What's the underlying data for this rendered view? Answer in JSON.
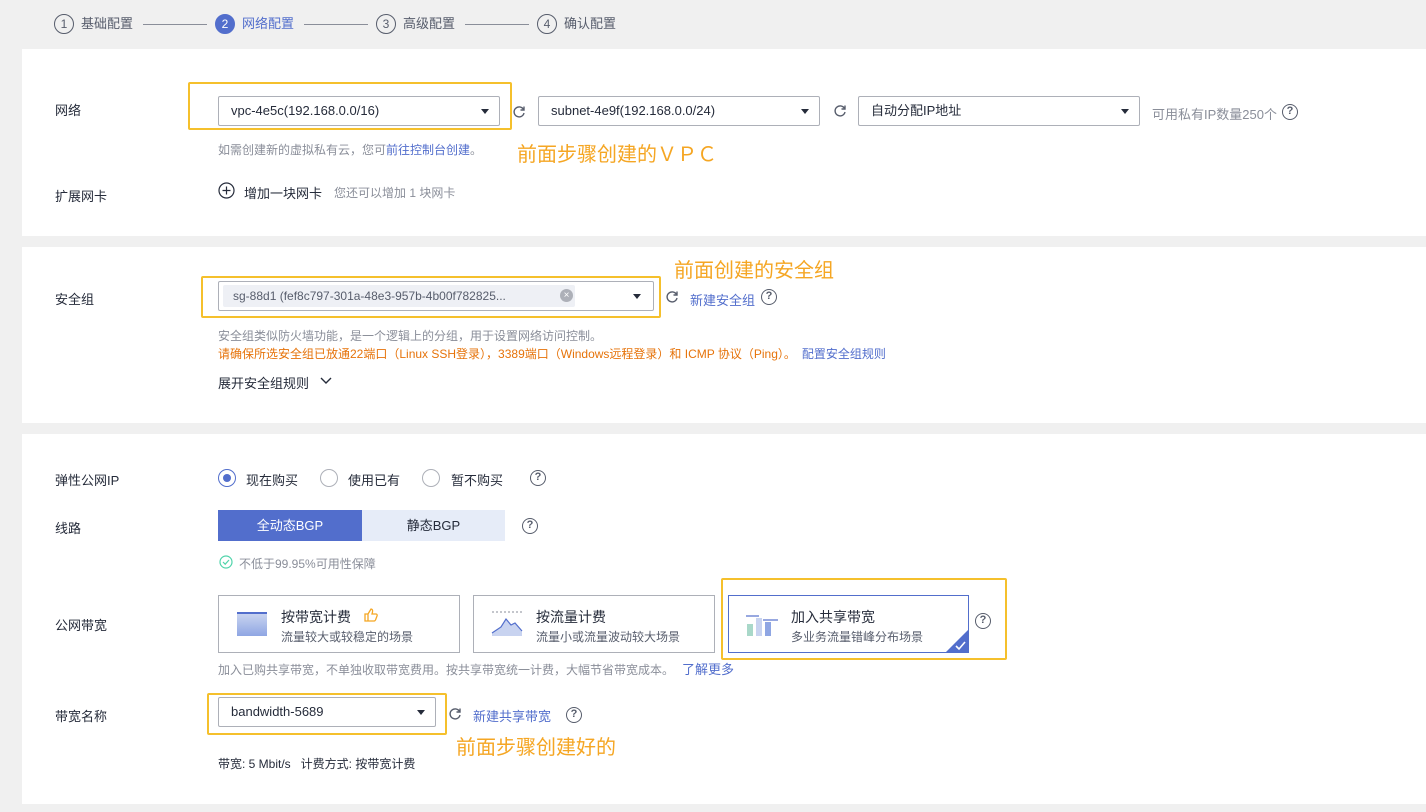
{
  "steps": [
    {
      "num": "1",
      "label": "基础配置"
    },
    {
      "num": "2",
      "label": "网络配置"
    },
    {
      "num": "3",
      "label": "高级配置"
    },
    {
      "num": "4",
      "label": "确认配置"
    }
  ],
  "network": {
    "label": "网络",
    "vpc_value": "vpc-4e5c(192.168.0.0/16)",
    "subnet_value": "subnet-4e9f(192.168.0.0/24)",
    "ip_value": "自动分配IP地址",
    "ip_count": "可用私有IP数量250个",
    "hint_prefix": "如需创建新的虚拟私有云，您可",
    "hint_link": "前往控制台创建",
    "hint_suffix": "。",
    "annotation": "前面步骤创建的ＶＰＣ"
  },
  "nic": {
    "label": "扩展网卡",
    "add_label": "增加一块网卡",
    "hint": "您还可以增加 1 块网卡"
  },
  "security": {
    "label": "安全组",
    "tag_value": "sg-88d1 (fef8c797-301a-48e3-957b-4b00f782825...",
    "new_link": "新建安全组",
    "annotation": "前面创建的安全组",
    "desc": "安全组类似防火墙功能，是一个逻辑上的分组，用于设置网络访问控制。",
    "warning": "请确保所选安全组已放通22端口（Linux SSH登录），3389端口（Windows远程登录）和 ICMP 协议（Ping）。",
    "rules_link": "配置安全组规则",
    "expand_label": "展开安全组规则"
  },
  "eip": {
    "label": "弹性公网IP",
    "options": [
      "现在购买",
      "使用已有",
      "暂不购买"
    ]
  },
  "line": {
    "label": "线路",
    "options": [
      "全动态BGP",
      "静态BGP"
    ],
    "guarantee": "不低于99.95%可用性保障"
  },
  "bandwidth": {
    "label": "公网带宽",
    "cards": [
      {
        "title": "按带宽计费",
        "desc": "流量较大或较稳定的场景"
      },
      {
        "title": "按流量计费",
        "desc": "流量小或流量波动较大场景"
      },
      {
        "title": "加入共享带宽",
        "desc": "多业务流量错峰分布场景"
      }
    ],
    "hint": "加入已购共享带宽，不单独收取带宽费用。按共享带宽统一计费，大幅节省带宽成本。",
    "learn_more": "了解更多"
  },
  "bw_name": {
    "label": "带宽名称",
    "value": "bandwidth-5689",
    "new_link": "新建共享带宽",
    "annotation": "前面步骤创建好的",
    "info": "带宽: 5 Mbit/s   计费方式: 按带宽计费"
  },
  "colors": {
    "accent": "#526ecc",
    "annotation": "#f5c02c",
    "warning": "#e6730a"
  }
}
